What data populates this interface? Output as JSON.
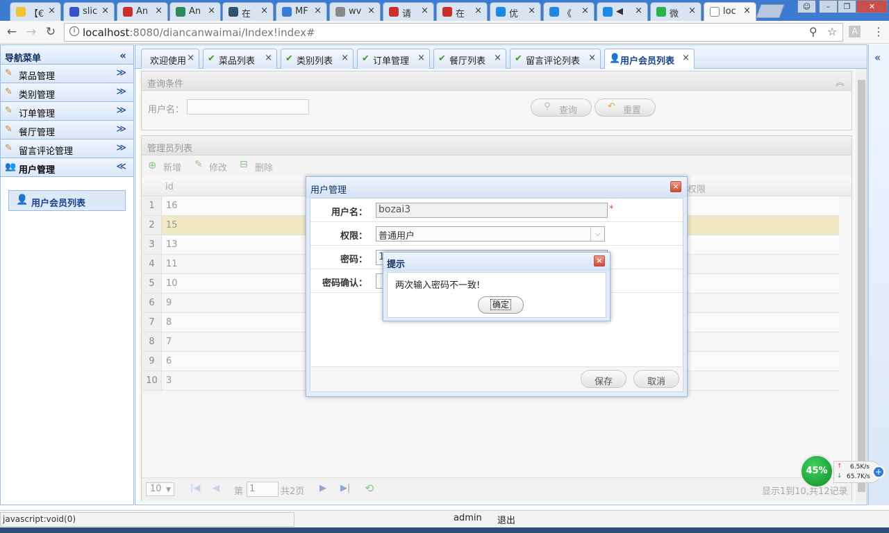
{
  "browser": {
    "tabs": [
      {
        "title": "【€",
        "favicon_color": "#f1c232"
      },
      {
        "title": "slic",
        "favicon_color": "#3552c9"
      },
      {
        "title": "An",
        "favicon_color": "#c9302c"
      },
      {
        "title": "An",
        "favicon_color": "#2e8b57"
      },
      {
        "title": "在",
        "favicon_color": "#34506b"
      },
      {
        "title": "MF",
        "favicon_color": "#3a7bd5"
      },
      {
        "title": "wv",
        "favicon_color": "#888888"
      },
      {
        "title": "请",
        "favicon_color": "#c9302c"
      },
      {
        "title": "在",
        "favicon_color": "#c9302c"
      },
      {
        "title": "优",
        "favicon_color": "#1e88e5"
      },
      {
        "title": "《",
        "favicon_color": "#1e88e5"
      },
      {
        "title": "◀",
        "favicon_color": "#1e88e5"
      },
      {
        "title": "微",
        "favicon_color": "#2bb24c"
      },
      {
        "title": "loc",
        "favicon_color": "#ffffff"
      }
    ],
    "url_host": "localhost",
    "url_rest": ":8080/diancanwaimai/Index!index#"
  },
  "sidebar": {
    "title": "导航菜单",
    "collapse_icon": "«",
    "sections": [
      {
        "label": "菜品管理",
        "toggle": "≫"
      },
      {
        "label": "类别管理",
        "toggle": "≫"
      },
      {
        "label": "订单管理",
        "toggle": "≫"
      },
      {
        "label": "餐厅管理",
        "toggle": "≫"
      },
      {
        "label": "留言评论管理",
        "toggle": "≫"
      },
      {
        "label": "用户管理",
        "toggle": "≪"
      }
    ],
    "active_item": "用户会员列表"
  },
  "main_tabs": [
    {
      "label": "欢迎使用",
      "close": "×"
    },
    {
      "label": "菜品列表",
      "close": "×"
    },
    {
      "label": "类别列表",
      "close": "×"
    },
    {
      "label": "订单管理",
      "close": "×"
    },
    {
      "label": "餐厅列表",
      "close": "×"
    },
    {
      "label": "留言评论列表",
      "close": "×"
    },
    {
      "label": "用户会员列表",
      "close": "×"
    }
  ],
  "query": {
    "title": "查询条件",
    "username_label": "用户名：",
    "search_button": "查询",
    "reset_button": "重置"
  },
  "grid": {
    "title": "管理员列表",
    "add": "新增",
    "edit": "修改",
    "delete": "删除",
    "col_id": "id",
    "col_perm": "权限",
    "rows": [
      {
        "n": "1",
        "id": "16"
      },
      {
        "n": "2",
        "id": "15"
      },
      {
        "n": "3",
        "id": "13"
      },
      {
        "n": "4",
        "id": "11"
      },
      {
        "n": "5",
        "id": "10"
      },
      {
        "n": "6",
        "id": "9"
      },
      {
        "n": "7",
        "id": "8"
      },
      {
        "n": "8",
        "id": "7"
      },
      {
        "n": "9",
        "id": "6"
      },
      {
        "n": "10",
        "id": "3"
      }
    ],
    "selected_row": 1,
    "pagination": {
      "page_size": "10",
      "page_prefix": "第",
      "page": "1",
      "page_suffix": "共2页",
      "summary": "显示1到10,共12记录"
    }
  },
  "dialog": {
    "title": "用户管理",
    "close": "×",
    "username_label": "用户名：",
    "username_value": "bozai3",
    "required_mark": "*",
    "perm_label": "权限：",
    "perm_value": "普通用户",
    "pwd_label": "密码：",
    "pwd_value": "1",
    "confirm_label": "密码确认：",
    "save": "保存",
    "cancel": "取消"
  },
  "alert": {
    "title": "提示",
    "close": "×",
    "message": "两次输入密码不一致!",
    "ok": "确定"
  },
  "statusbar": {
    "link_hint": "javascript:void(0)",
    "user": "admin",
    "logout": "退出"
  },
  "network_widget": {
    "percent": "45%",
    "up": "6.5K/s",
    "down": "65.7K/s"
  }
}
